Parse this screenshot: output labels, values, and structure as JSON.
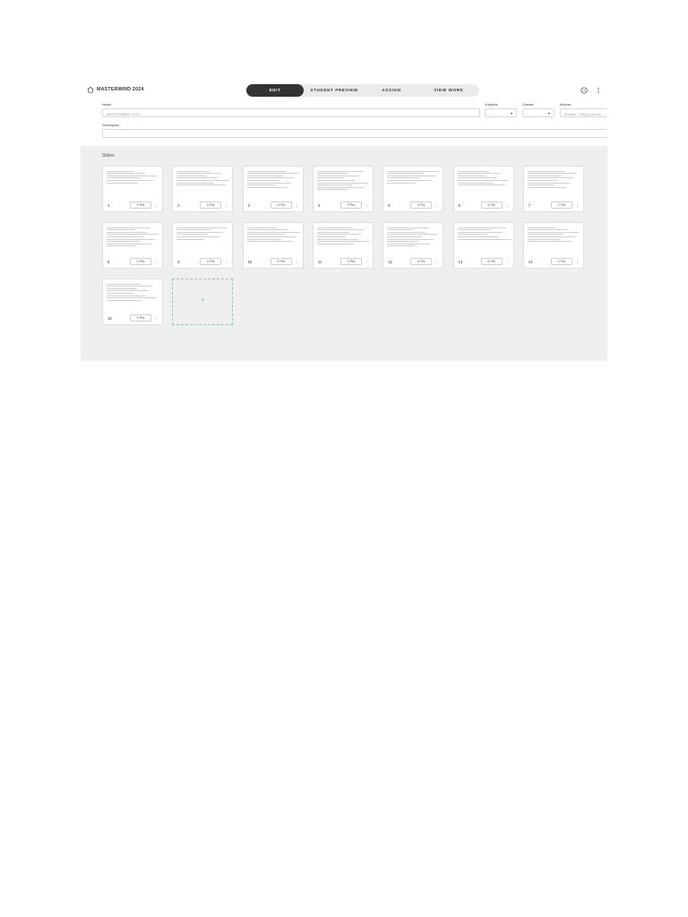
{
  "header": {
    "title": "MASTERMIND 2024",
    "tabs": [
      {
        "label": "EDIT",
        "active": true
      },
      {
        "label": "STUDENT PREVIEW",
        "active": false
      },
      {
        "label": "ASSIGN",
        "active": false
      },
      {
        "label": "VIEW WORK",
        "active": false
      }
    ],
    "icons": [
      "home-icon",
      "help-icon",
      "more-vertical-icon"
    ]
  },
  "form": {
    "name_label": "Name",
    "name_value": "MASTERMIND 2024",
    "subjects_label": "Subjects",
    "subjects_value": "--",
    "grades_label": "Grades",
    "grades_value": "--",
    "access_label": "Access",
    "access_value": "Private - Only your trus",
    "description_label": "Description",
    "description_value": ""
  },
  "slides": {
    "title": "Slides",
    "items": [
      {
        "number": "1",
        "points": "0 Pts"
      },
      {
        "number": "2",
        "points": "0 Pts"
      },
      {
        "number": "3",
        "points": "0 Pts"
      },
      {
        "number": "4",
        "points": "0 Pts"
      },
      {
        "number": "5",
        "points": "0 Pts"
      },
      {
        "number": "6",
        "points": "0 Pts"
      },
      {
        "number": "7",
        "points": "0 Pts"
      },
      {
        "number": "8",
        "points": "0 Pts"
      },
      {
        "number": "9",
        "points": "0 Pts"
      },
      {
        "number": "10",
        "points": "0 Pts"
      },
      {
        "number": "11",
        "points": "0 Pts"
      },
      {
        "number": "12",
        "points": "0 Pts"
      },
      {
        "number": "13",
        "points": "0 Pts"
      },
      {
        "number": "14",
        "points": "0 Pts"
      },
      {
        "number": "15",
        "points": "0 Pts"
      }
    ],
    "add_label": "+"
  },
  "colors": {
    "tab_active_bg": "#333333",
    "slides_bg": "#efefef",
    "add_card_accent": "#4fb89d"
  }
}
